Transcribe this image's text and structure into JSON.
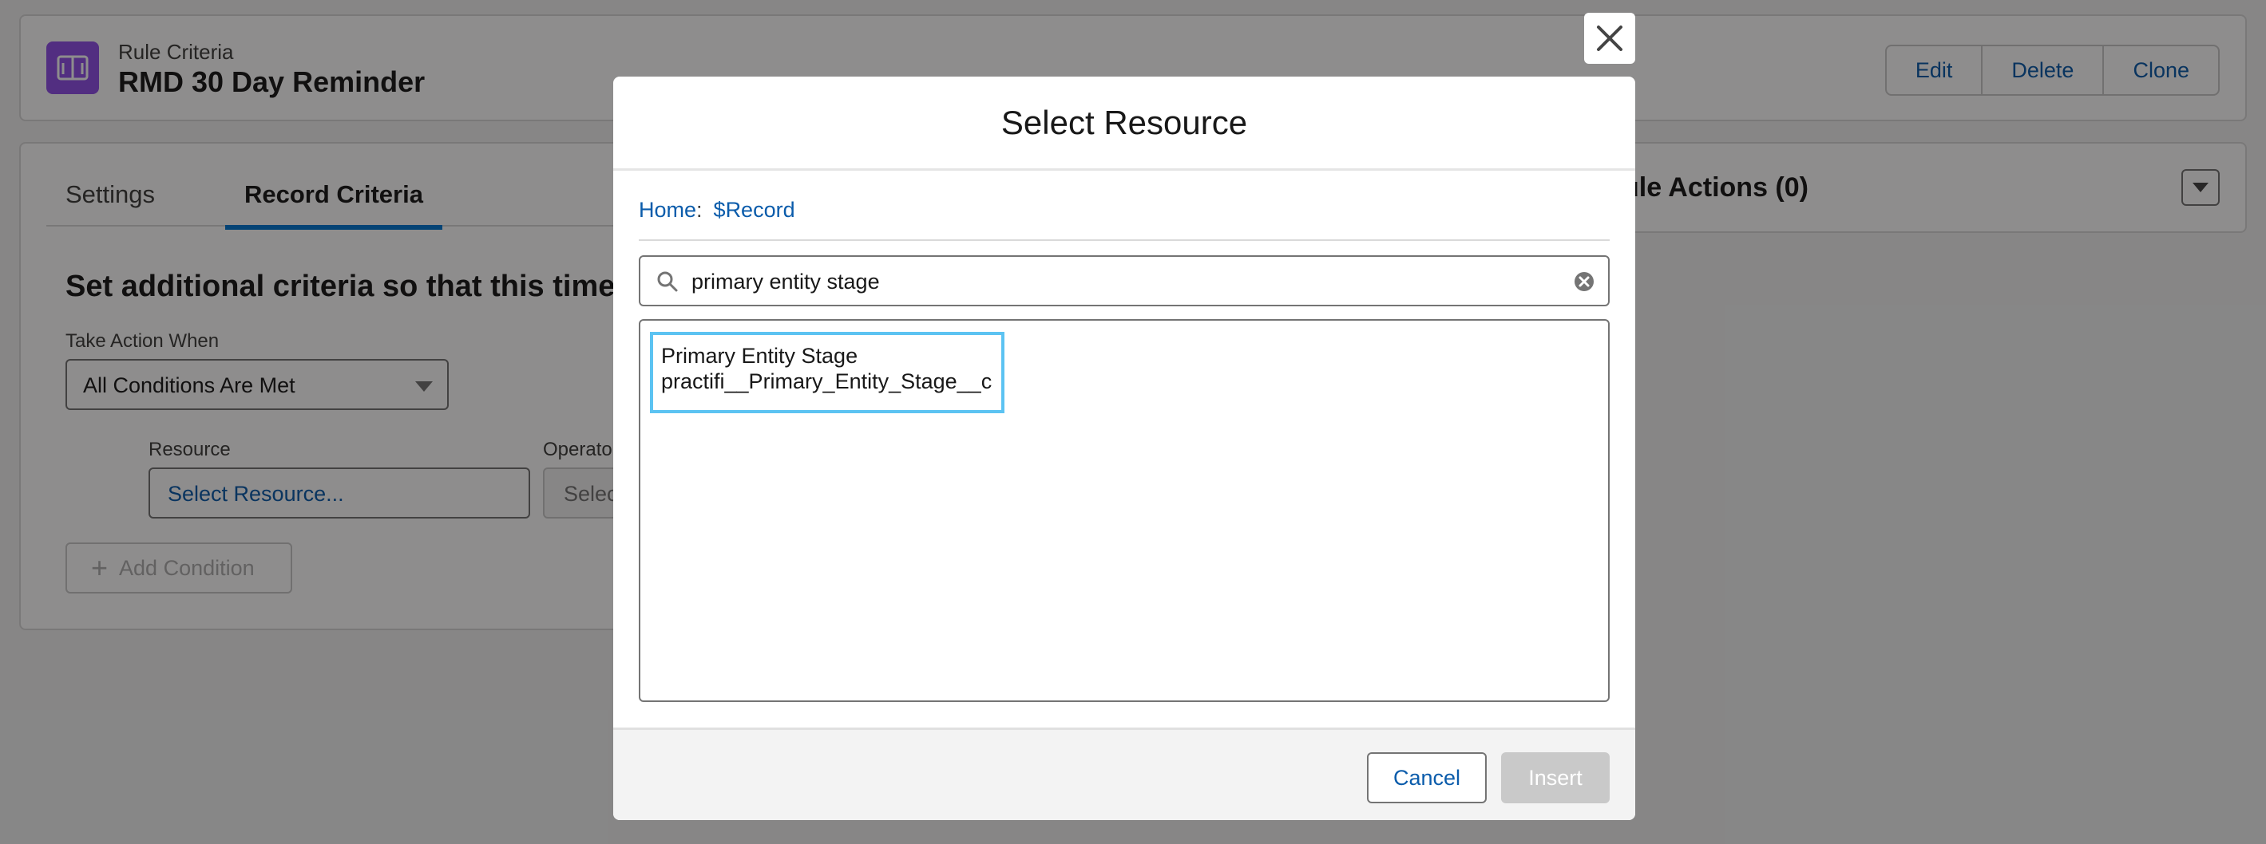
{
  "header": {
    "subtitle": "Rule Criteria",
    "title": "RMD 30 Day Reminder",
    "buttons": {
      "edit": "Edit",
      "delete": "Delete",
      "clone": "Clone"
    }
  },
  "main": {
    "tabs": [
      "Settings",
      "Record Criteria"
    ],
    "active_tab": "Record Criteria",
    "heading": "Set additional criteria so that this time-b",
    "take_action_label": "Take Action When",
    "take_action_value": "All Conditions Are Met",
    "resource_label": "Resource",
    "resource_placeholder": "Select Resource...",
    "operator_label": "Operato",
    "operator_placeholder": "Selec",
    "add_condition": "Add Condition"
  },
  "rule_actions": {
    "title": "ule Actions (0)"
  },
  "modal": {
    "title": "Select Resource",
    "breadcrumb": {
      "home": "Home",
      "separator": ":",
      "current": "$Record"
    },
    "search_value": "primary entity stage",
    "results": [
      {
        "label": "Primary Entity Stage",
        "api_name": "practifi__Primary_Entity_Stage__c"
      }
    ],
    "cancel": "Cancel",
    "insert": "Insert"
  },
  "colors": {
    "brand_link": "#0b5cab",
    "app_icon": "#9050e9",
    "active_tab_underline": "#0176d3",
    "result_highlight": "#5cc3f2"
  },
  "icons": [
    "book-icon",
    "caret-down-icon",
    "plus-icon",
    "close-icon",
    "search-icon",
    "clear-icon"
  ]
}
